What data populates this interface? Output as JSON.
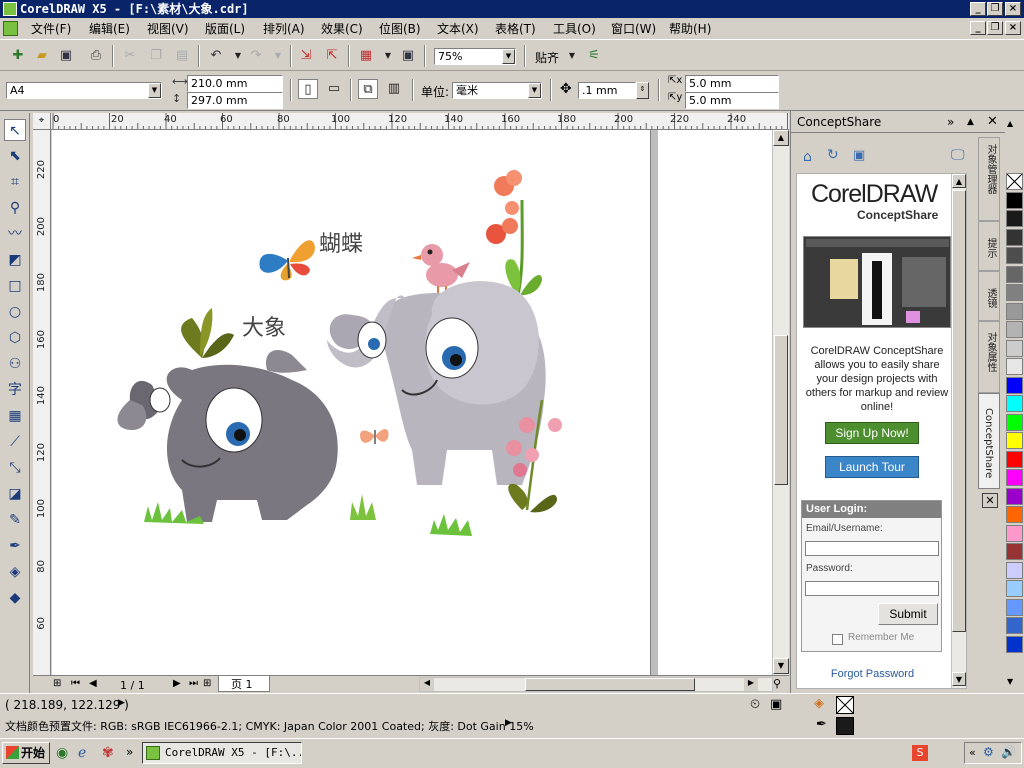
{
  "window": {
    "title": "CorelDRAW X5 - [F:\\素材\\大象.cdr]"
  },
  "menu": {
    "items": [
      "文件(F)",
      "编辑(E)",
      "视图(V)",
      "版面(L)",
      "排列(A)",
      "效果(C)",
      "位图(B)",
      "文本(X)",
      "表格(T)",
      "工具(O)",
      "窗口(W)",
      "帮助(H)"
    ]
  },
  "standard_toolbar": {
    "zoom": "75%",
    "snap_label": "贴齐"
  },
  "property_bar": {
    "paper_size": "A4",
    "width": "210.0 mm",
    "height": "297.0 mm",
    "units_label": "单位:",
    "units_value": "毫米",
    "nudge": ".1 mm",
    "dup_x": "5.0 mm",
    "dup_y": "5.0 mm"
  },
  "rulers": {
    "horizontal_ticks": [
      "0",
      "20",
      "40",
      "60",
      "80",
      "100",
      "120",
      "140",
      "160",
      "180",
      "200",
      "220",
      "240"
    ],
    "vertical_ticks": [
      "220",
      "200",
      "180",
      "160",
      "140",
      "120",
      "100",
      "80",
      "60"
    ]
  },
  "artwork": {
    "label_butterfly": "蝴蝶",
    "label_elephant": "大象"
  },
  "page_nav": {
    "page_counter": "1 / 1",
    "page_tab": "页 1"
  },
  "docker": {
    "title": "ConceptShare",
    "logo_line1": "CorelDRAW",
    "logo_line2": "ConceptShare",
    "description": "CorelDRAW ConceptShare allows you to easily share your design projects with others for markup and review online!",
    "signup_button": "Sign Up Now!",
    "tour_button": "Launch Tour",
    "login_heading": "User Login:",
    "email_label": "Email/Username:",
    "password_label": "Password:",
    "submit_button": "Submit",
    "remember_label": "Remember Me",
    "forgot_link": "Forgot Password"
  },
  "side_tabs": [
    "对象管理器",
    "提示",
    "透镜",
    "对象属性",
    "ConceptShare"
  ],
  "palette_colors": [
    "#ffffff",
    "#000000",
    "#1a1a1a",
    "#333333",
    "#4d4d4d",
    "#666666",
    "#808080",
    "#999999",
    "#b3b3b3",
    "#cccccc",
    "#e6e6e6",
    "#0000ff",
    "#00ffff",
    "#00ff00",
    "#ffff00",
    "#ff0000",
    "#ff00ff",
    "#9900cc",
    "#ff6600",
    "#ff99cc",
    "#993333",
    "#ccccff",
    "#99ccff",
    "#6699ff",
    "#3366cc",
    "#0033cc"
  ],
  "status": {
    "cursor_position": "( 218.189, 122.129 )",
    "color_profiles": "文档颜色预置文件: RGB: sRGB IEC61966-2.1; CMYK: Japan Color 2001 Coated; 灰度: Dot Gain 15%"
  },
  "taskbar": {
    "start_label": "开始",
    "task_item": "CorelDRAW X5 - [F:\\..."
  }
}
